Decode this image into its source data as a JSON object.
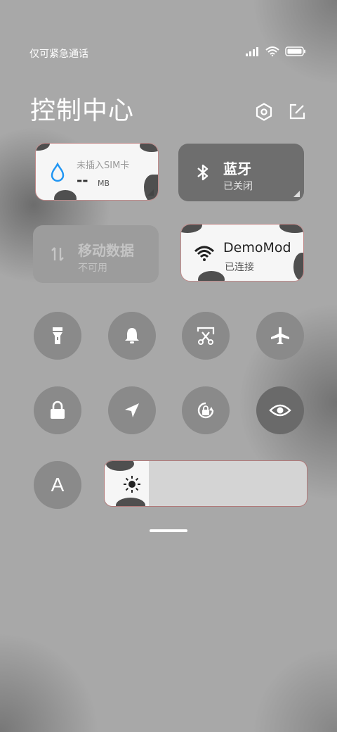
{
  "status_bar": {
    "carrier_text": "仅可紧急通话",
    "icons": [
      "signal-icon",
      "wifi-icon",
      "battery-icon"
    ]
  },
  "header": {
    "title": "控制中心",
    "settings_icon": "settings-hex-icon",
    "edit_icon": "edit-icon"
  },
  "tiles": [
    {
      "id": "data-usage",
      "title": "未插入SIM卡",
      "value": "--",
      "unit": "MB",
      "icon": "water-drop-icon",
      "style": "light"
    },
    {
      "id": "bluetooth",
      "title": "蓝牙",
      "subtitle": "已关闭",
      "icon": "bluetooth-icon",
      "style": "dark"
    },
    {
      "id": "mobile-data",
      "title": "移动数据",
      "subtitle": "不可用",
      "icon": "data-arrows-icon",
      "style": "disabled"
    },
    {
      "id": "wifi",
      "title": "DemoMod",
      "subtitle": "已连接",
      "icon": "wifi-icon",
      "style": "light"
    }
  ],
  "toggles_row1": [
    "flashlight-icon",
    "bell-icon",
    "screenshot-icon",
    "airplane-icon"
  ],
  "toggles_row2": [
    "lock-icon",
    "location-icon",
    "rotation-lock-icon",
    "eye-icon"
  ],
  "font_button_label": "A",
  "brightness": {
    "icon": "sun-icon",
    "level": 0.22
  },
  "colors": {
    "accent_blue": "#2196f3",
    "tile_dark": "#6e6e6e",
    "round_button": "#8a8a8a"
  }
}
